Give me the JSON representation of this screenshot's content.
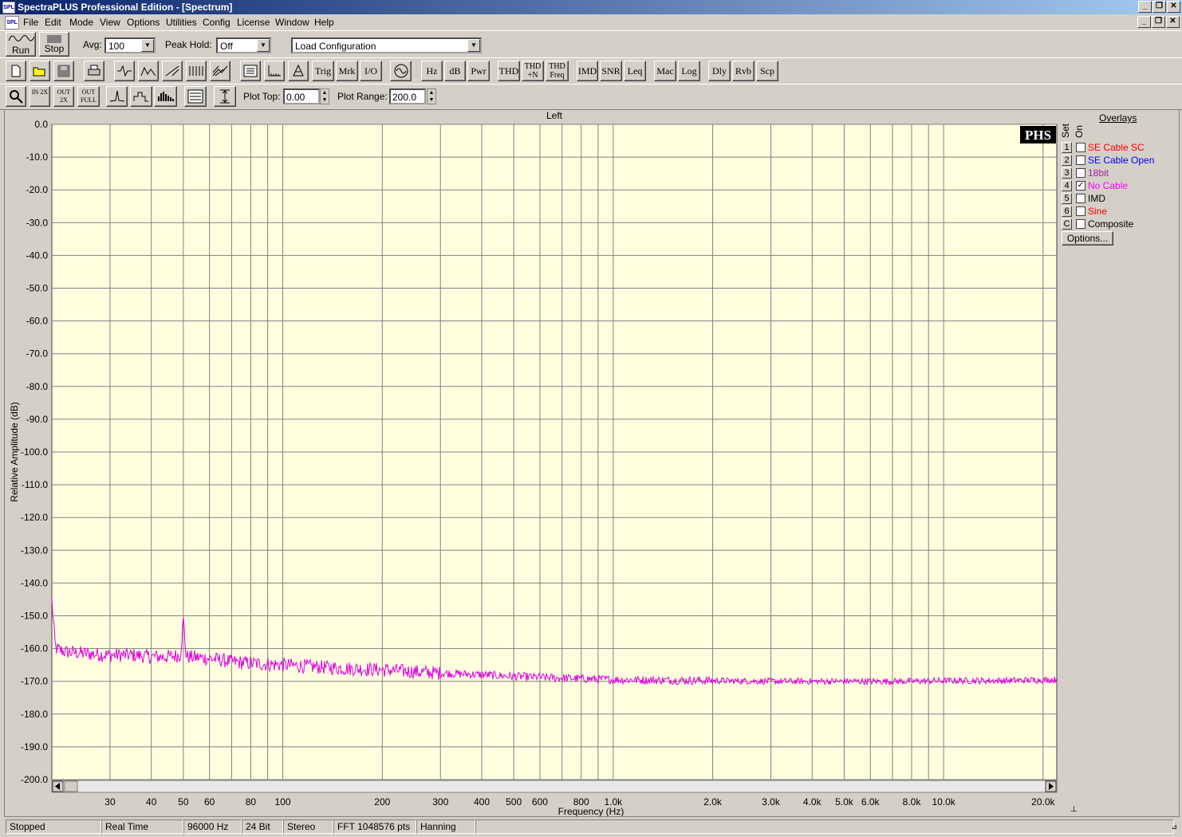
{
  "window": {
    "title": "SpectraPLUS Professional Edition - [Spectrum]",
    "icon_text": "SPL"
  },
  "menu": [
    "File",
    "Edit",
    "Mode",
    "View",
    "Options",
    "Utilities",
    "Config",
    "License",
    "Window",
    "Help"
  ],
  "toolbar1": {
    "run_label": "Run",
    "stop_label": "Stop",
    "avg_label": "Avg:",
    "avg_value": "100",
    "peak_hold_label": "Peak Hold:",
    "peak_hold_value": "Off",
    "config_value": "Load Configuration"
  },
  "toolbar2": [
    "Trig",
    "Mrk",
    "I/O",
    "Hz",
    "dB",
    "Pwr",
    "THD",
    "THD +N",
    "THD Freq",
    "IMD",
    "SNR",
    "Leq",
    "Mac",
    "Log",
    "Dly",
    "Rvb",
    "Scp"
  ],
  "toolbar3": {
    "zoom_labels": [
      "",
      "IN 2X",
      "OUT 2X",
      "OUT FULL"
    ],
    "plot_top_label": "Plot Top:",
    "plot_top_value": "0.00",
    "plot_range_label": "Plot Range:",
    "plot_range_value": "200.0"
  },
  "overlays": {
    "title": "Overlays",
    "set_label": "Set",
    "on_label": "On",
    "items": [
      {
        "set": "1",
        "name": "SE Cable SC",
        "color": "#ff0000",
        "on": false
      },
      {
        "set": "2",
        "name": "SE Cable Open",
        "color": "#0000ff",
        "on": false
      },
      {
        "set": "3",
        "name": "18bit",
        "color": "#a020a0",
        "on": false
      },
      {
        "set": "4",
        "name": "No Cable",
        "color": "#ff00ff",
        "on": true
      },
      {
        "set": "5",
        "name": "IMD",
        "color": "#000000",
        "on": false
      },
      {
        "set": "6",
        "name": "Sine",
        "color": "#ff0000",
        "on": false
      },
      {
        "set": "C",
        "name": "Composite",
        "color": "#000000",
        "on": false
      }
    ],
    "options_label": "Options...",
    "check_mark": "✓"
  },
  "chart_data": {
    "type": "line",
    "title": "Left",
    "logo": "PHS",
    "xlabel": "Frequency (Hz)",
    "ylabel": "Relative Amplitude (dB)",
    "x_scale": "log",
    "xlim": [
      20,
      22000
    ],
    "ylim": [
      -200,
      0
    ],
    "y_ticks": [
      "0.0",
      "-10.0",
      "-20.0",
      "-30.0",
      "-40.0",
      "-50.0",
      "-60.0",
      "-70.0",
      "-80.0",
      "-90.0",
      "-100.0",
      "-110.0",
      "-120.0",
      "-130.0",
      "-140.0",
      "-150.0",
      "-160.0",
      "-170.0",
      "-180.0",
      "-190.0",
      "-200.0"
    ],
    "x_ticks": [
      {
        "v": 30,
        "t": "30"
      },
      {
        "v": 40,
        "t": "40"
      },
      {
        "v": 50,
        "t": "50"
      },
      {
        "v": 60,
        "t": "60"
      },
      {
        "v": 80,
        "t": "80"
      },
      {
        "v": 100,
        "t": "100"
      },
      {
        "v": 200,
        "t": "200"
      },
      {
        "v": 300,
        "t": "300"
      },
      {
        "v": 400,
        "t": "400"
      },
      {
        "v": 500,
        "t": "500"
      },
      {
        "v": 600,
        "t": "600"
      },
      {
        "v": 800,
        "t": "800"
      },
      {
        "v": 1000,
        "t": "1.0k"
      },
      {
        "v": 2000,
        "t": "2.0k"
      },
      {
        "v": 3000,
        "t": "3.0k"
      },
      {
        "v": 4000,
        "t": "4.0k"
      },
      {
        "v": 5000,
        "t": "5.0k"
      },
      {
        "v": 6000,
        "t": "6.0k"
      },
      {
        "v": 8000,
        "t": "8.0k"
      },
      {
        "v": 10000,
        "t": "10.0k"
      },
      {
        "v": 20000,
        "t": "20.0k"
      }
    ],
    "minor_x": [
      70,
      90,
      700,
      900,
      7000,
      9000
    ],
    "grid": true,
    "series": [
      {
        "color": "#e000e0",
        "points": [
          [
            20,
            -145
          ],
          [
            20.5,
            -160
          ],
          [
            22,
            -161
          ],
          [
            25,
            -161.5
          ],
          [
            30,
            -162
          ],
          [
            35,
            -162
          ],
          [
            40,
            -162.5
          ],
          [
            45,
            -162.5
          ],
          [
            49,
            -162
          ],
          [
            50,
            -151
          ],
          [
            51,
            -162.5
          ],
          [
            60,
            -163
          ],
          [
            70,
            -164
          ],
          [
            80,
            -164.5
          ],
          [
            100,
            -165
          ],
          [
            150,
            -166
          ],
          [
            200,
            -166.5
          ],
          [
            300,
            -167.5
          ],
          [
            400,
            -168
          ],
          [
            500,
            -168.5
          ],
          [
            700,
            -169
          ],
          [
            1000,
            -169.5
          ],
          [
            2000,
            -169.8
          ],
          [
            3000,
            -170
          ],
          [
            5000,
            -170
          ],
          [
            8000,
            -170
          ],
          [
            10000,
            -169.8
          ],
          [
            15000,
            -169.8
          ],
          [
            22000,
            -169.5
          ]
        ]
      }
    ]
  },
  "status": [
    "Stopped",
    "Real Time",
    "96000 Hz",
    "24 Bit",
    "Stereo",
    "FFT 1048576 pts",
    "Hanning"
  ]
}
